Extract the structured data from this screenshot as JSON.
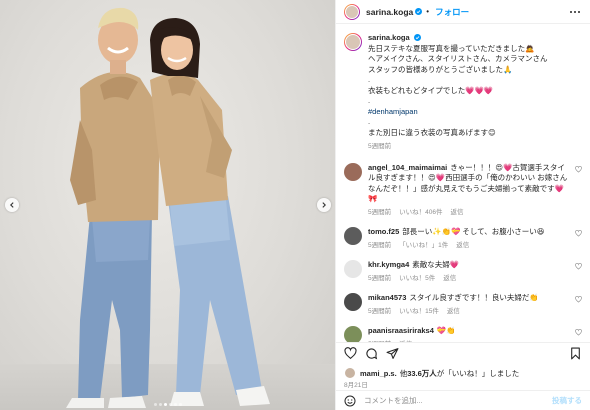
{
  "post": {
    "username": "sarina.koga",
    "follow_label": "フォロー",
    "caption_lines": [
      "先日ステキな夏服写真を撮っていただきました🙇",
      "ヘアメイクさん、スタイリストさん、カメラマンさん",
      "スタッフの皆様ありがとうございました🙏",
      ".",
      "衣装もどれもどタイプでした💗💗💗",
      ".",
      "#denhamjapan",
      ".",
      "また別日に違う衣装の写真あげます😊"
    ],
    "caption_time": "5週間前"
  },
  "comments": [
    {
      "username": "angel_104_maimaimai",
      "text": "きゃー！！！😍💗古賀選手スタイル良すぎます！！😍💗西田選手の「俺のかわいい お嫁さんなんだぞ！！」感が丸見えでもうご夫婦揃って素敵です💗🎀",
      "time": "5週間前",
      "likes": "いいね！406件",
      "reply": "返信",
      "avatar_color": "#9a6b5a"
    },
    {
      "username": "tomo.f25",
      "text": "部長ーい✨👏💝 そして、お腹小さーい😆",
      "time": "5週間前",
      "likes": "「いいね！」1件",
      "reply": "返信",
      "avatar_color": "#5c5c5c"
    },
    {
      "username": "khr.kymga4",
      "text": "素敵な夫婦💗",
      "time": "5週間前",
      "likes": "いいね！5件",
      "reply": "返信",
      "avatar_color": "#e6e6e6"
    },
    {
      "username": "mikan4573",
      "text": "スタイル良すぎです！！良い夫婦だ👏",
      "time": "5週間前",
      "likes": "いいね！15件",
      "reply": "返信",
      "avatar_color": "#4a4a4a"
    },
    {
      "username": "paanisraasiriraks4",
      "text": "💝👏",
      "time": "5週間前",
      "likes": "",
      "reply": "返信",
      "avatar_color": "#7c8f5a"
    }
  ],
  "likes_bar": {
    "username": "mami_p.s.",
    "text_mid": "他",
    "count": "33.6万人",
    "text_end": "が「いいね！」しました",
    "date": "8月21日"
  },
  "comment_input": {
    "placeholder": "コメントを追加...",
    "post_label": "投稿する"
  },
  "carousel": {
    "count": 6,
    "active": 2
  },
  "colors": {
    "accent": "#0095f6",
    "hashtag": "#00376b",
    "verified": "#0095f6"
  },
  "icons": [
    "heart-icon",
    "comment-icon",
    "share-icon",
    "bookmark-icon",
    "emoji-icon",
    "verified-icon",
    "more-icon",
    "chevron-left-icon",
    "chevron-right-icon"
  ]
}
